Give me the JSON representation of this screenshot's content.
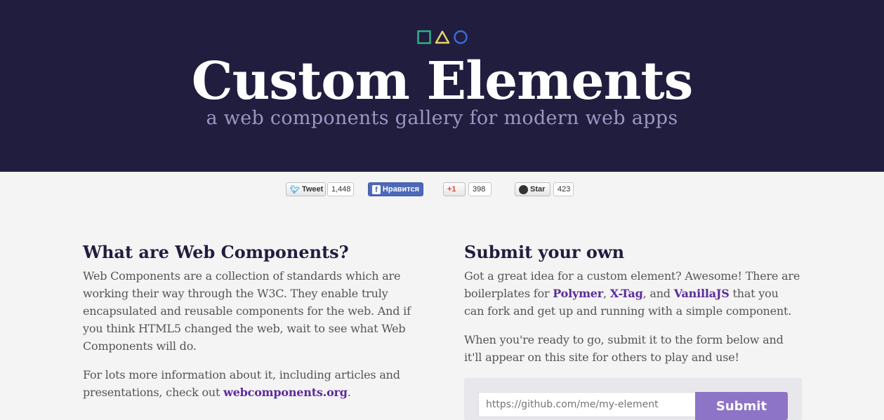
{
  "hero": {
    "title": "Custom Elements",
    "subtitle": "a web components gallery for modern web apps",
    "logo_icons": [
      "square-icon",
      "triangle-icon",
      "circle-icon"
    ],
    "colors": {
      "background": "#211d3f",
      "square": "#2fb183",
      "triangle": "#e8d364",
      "circle": "#3b6ad6"
    }
  },
  "social": {
    "tweet_label": "Tweet",
    "tweet_count": "1,448",
    "like_label": "Нравится",
    "gplus_label": "+1",
    "gplus_count": "398",
    "github_label": "Star",
    "github_count": "423"
  },
  "left": {
    "heading": "What are Web Components?",
    "p1": "Web Components are a collection of standards which are working their way through the W3C. They enable truly encapsulated and reusable components for the web. And if you think HTML5 changed the web, wait to see what Web Components will do.",
    "p2_prefix": "For lots more information about it, including articles and presentations, check out ",
    "p2_link": "webcomponents.org",
    "p2_suffix": "."
  },
  "right": {
    "heading": "Submit your own",
    "p1_a": "Got a great idea for a custom element? Awesome! There are boilerplates for ",
    "link_polymer": "Polymer",
    "sep1": ", ",
    "link_xtag": "X-Tag",
    "sep2": ", and ",
    "link_vanilla": "VanillaJS",
    "p1_b": " that you can fork and get up and running with a simple component.",
    "p2": "When you're ready to go, submit it to the form below and it'll appear on this site for others to play and use!"
  },
  "form": {
    "placeholder": "https://github.com/me/my-element",
    "submit_label": "Submit"
  }
}
